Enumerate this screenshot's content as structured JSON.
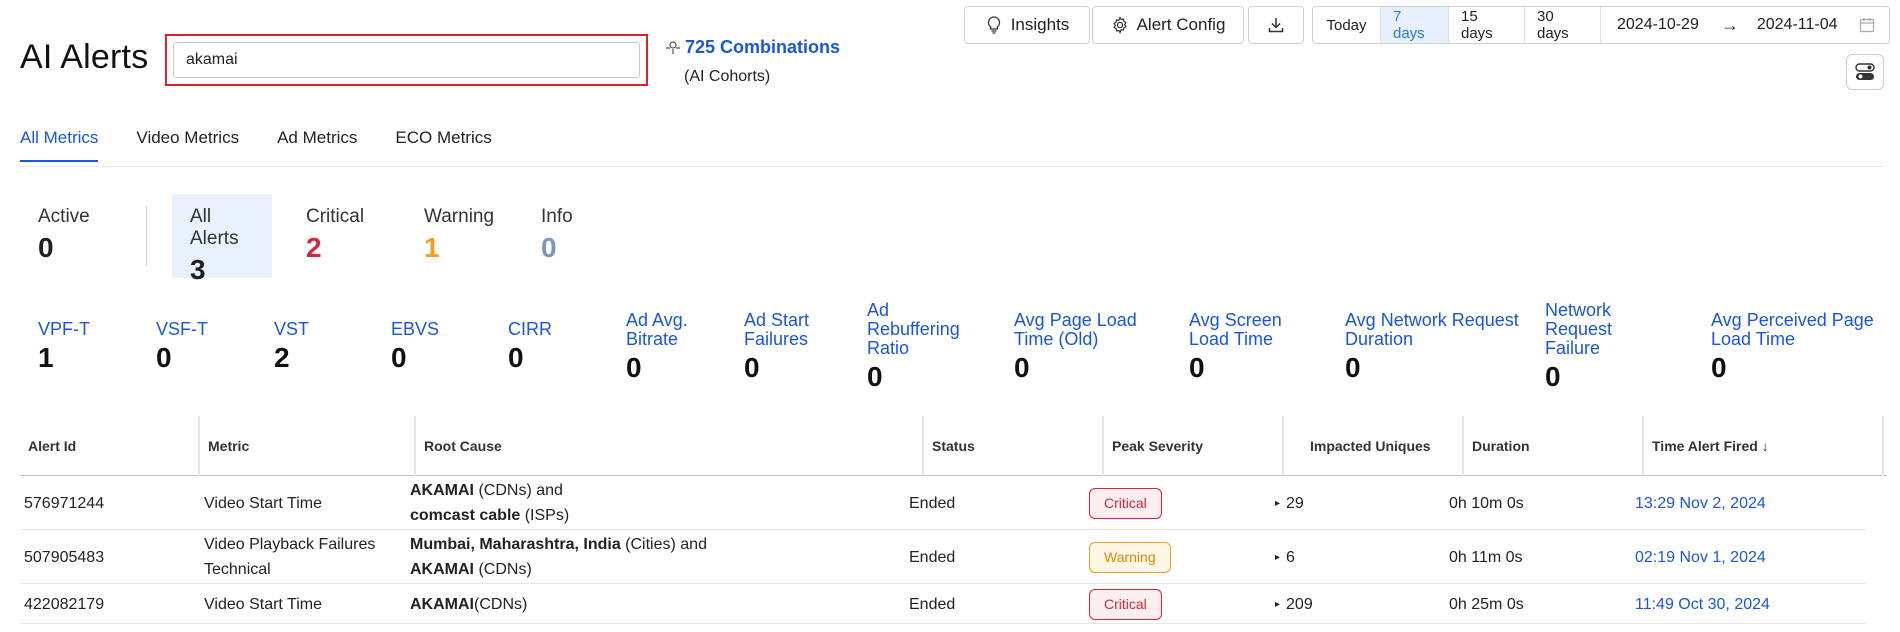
{
  "header": {
    "title": "AI Alerts",
    "search": {
      "value": "akamai",
      "placeholder": ""
    },
    "combinations": {
      "label": "725 Combinations",
      "sub": "(AI Cohorts)"
    }
  },
  "toolbar": {
    "insights_label": "Insights",
    "alert_config_label": "Alert Config"
  },
  "date_range": {
    "options": [
      "Today",
      "7 days",
      "15 days",
      "30 days"
    ],
    "active": "7 days",
    "start": "2024-10-29",
    "end": "2024-11-04"
  },
  "tabs": [
    {
      "label": "All Metrics",
      "active": true
    },
    {
      "label": "Video Metrics",
      "active": false
    },
    {
      "label": "Ad Metrics",
      "active": false
    },
    {
      "label": "ECO Metrics",
      "active": false
    }
  ],
  "counters": {
    "active": {
      "label": "Active",
      "value": "0"
    },
    "all": {
      "label": "All Alerts",
      "value": "3"
    },
    "critical": {
      "label": "Critical",
      "value": "2",
      "color": "#d9263a"
    },
    "warning": {
      "label": "Warning",
      "value": "1",
      "color": "#f0a020"
    },
    "info": {
      "label": "Info",
      "value": "0",
      "color": "#7b97b8"
    }
  },
  "metrics": [
    {
      "label": "VPF-T",
      "value": "1"
    },
    {
      "label": "VSF-T",
      "value": "0"
    },
    {
      "label": "VST",
      "value": "2"
    },
    {
      "label": "EBVS",
      "value": "0"
    },
    {
      "label": "CIRR",
      "value": "0"
    },
    {
      "label": "Ad Avg. Bitrate",
      "value": "0"
    },
    {
      "label": "Ad Start Failures",
      "value": "0"
    },
    {
      "label": "Ad Rebuffering Ratio",
      "value": "0"
    },
    {
      "label": "Avg Page Load Time (Old)",
      "value": "0"
    },
    {
      "label": "Avg Screen Load Time",
      "value": "0"
    },
    {
      "label": "Avg Network Request Duration",
      "value": "0"
    },
    {
      "label": "Network Request Failure",
      "value": "0"
    },
    {
      "label": "Avg Perceived Page Load Time",
      "value": "0"
    }
  ],
  "table": {
    "columns": [
      "Alert Id",
      "Metric",
      "Root Cause",
      "Status",
      "Peak Severity",
      "Impacted Uniques",
      "Duration",
      "Time Alert Fired ↓"
    ],
    "rows": [
      {
        "id": "576971244",
        "metric": "Video Start Time",
        "rc1_bold": "AKAMAI",
        "rc1_rest": " (CDNs) and",
        "rc2_bold": "comcast cable",
        "rc2_rest": " (ISPs)",
        "status": "Ended",
        "severity": "Critical",
        "uniques": "29",
        "duration": "0h 10m 0s",
        "fired": "13:29 Nov 2, 2024"
      },
      {
        "id": "507905483",
        "metric": "Video Playback Failures Technical",
        "rc1_bold": "Mumbai, Maharashtra, India",
        "rc1_rest": " (Cities) and",
        "rc2_bold": "AKAMAI",
        "rc2_rest": " (CDNs)",
        "status": "Ended",
        "severity": "Warning",
        "uniques": "6",
        "duration": "0h 11m 0s",
        "fired": "02:19 Nov 1, 2024"
      },
      {
        "id": "422082179",
        "metric": "Video Start Time",
        "rc1_bold": "AKAMAI",
        "rc1_rest": " (CDNs)",
        "rc2_bold": "",
        "rc2_rest": "",
        "status": "Ended",
        "severity": "Critical",
        "uniques": "209",
        "duration": "0h 25m 0s",
        "fired": "11:49 Oct 30, 2024"
      }
    ]
  }
}
